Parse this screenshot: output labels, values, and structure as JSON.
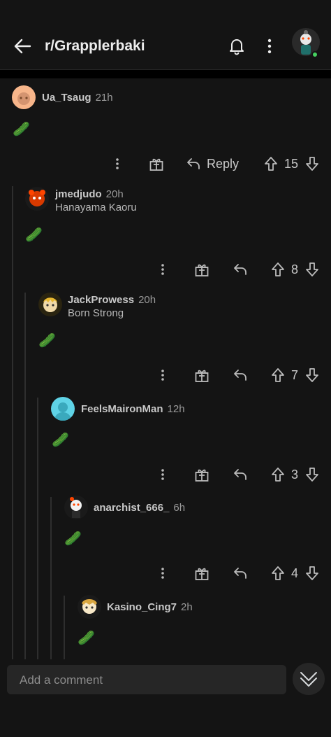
{
  "header": {
    "title": "r/Grapplerbaki"
  },
  "composer": {
    "placeholder": "Add a comment"
  },
  "comments": [
    {
      "user": "Ua_Tsaug",
      "age": "21h",
      "flair": "",
      "body": "🥒",
      "votes": "15",
      "reply_label": "Reply"
    },
    {
      "user": "jmedjudo",
      "age": "20h",
      "flair": "Hanayama Kaoru",
      "body": "🥒",
      "votes": "8"
    },
    {
      "user": "JackProwess",
      "age": "20h",
      "flair": "Born Strong",
      "body": "🥒",
      "votes": "7"
    },
    {
      "user": "FeelsMaironMan",
      "age": "12h",
      "flair": "",
      "body": "🥒",
      "votes": "3"
    },
    {
      "user": "anarchist_666_",
      "age": "6h",
      "flair": "",
      "body": "🥒",
      "votes": "4"
    },
    {
      "user": "Kasino_Cing7",
      "age": "2h",
      "flair": "",
      "body": "🥒",
      "votes": ""
    }
  ],
  "icons": [
    "back-arrow-icon",
    "bell-icon",
    "more-vertical-icon",
    "award-icon",
    "reply-icon",
    "upvote-icon",
    "downvote-icon",
    "collapse-chevron-icon"
  ],
  "colors": {
    "background": "#141414",
    "text": "#d7dadc",
    "online": "#46d160"
  }
}
